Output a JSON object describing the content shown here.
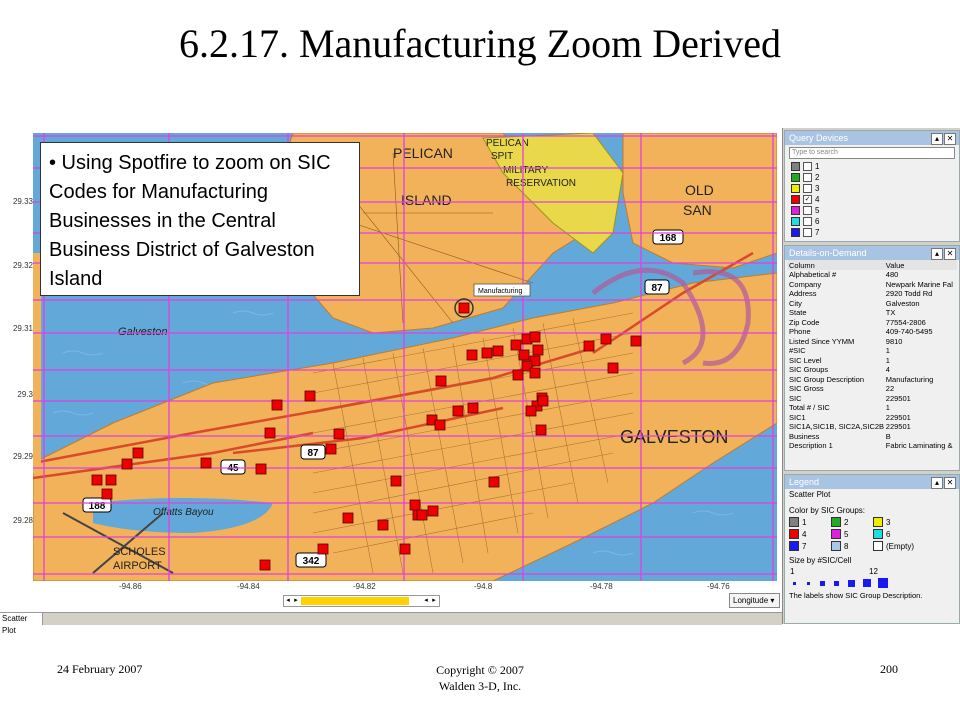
{
  "slide": {
    "title": "6.2.17. Manufacturing Zoom Derived",
    "footer_date": "24 February 2007",
    "footer_copyright_line1": "Copyright © 2007",
    "footer_copyright_line2": "Walden 3-D, Inc.",
    "page_number": "200"
  },
  "callout": {
    "text": "• Using Spotfire to zoom on SIC Codes for Manufacturing Businesses in the Central Business District of Galveston Island"
  },
  "plot": {
    "y_ticks": [
      "29.33",
      "29.32",
      "29.31",
      "29.3",
      "29.29",
      "29.28"
    ],
    "x_ticks": [
      "-94.86",
      "-94.84",
      "-94.82",
      "-94.8",
      "-94.78",
      "-94.76"
    ],
    "x_axis_column": "Longitude",
    "tab_label": "Scatter Plot",
    "marker_label": "Manufacturing",
    "marker_color": "#ee0000",
    "grid_color": "#e040e0"
  },
  "map_labels": {
    "pelican_island": "PELICAN",
    "island": "ISLAND",
    "pelican_spit": "PELICAN",
    "spit": "SPIT",
    "military": "MILITARY",
    "reservation": "RESERVATION",
    "old": "OLD",
    "san": "SAN",
    "galveston": "GALVESTON",
    "galveston_channel": "Galveston",
    "offatts_bayou": "Offatts Bayou",
    "scholes": "SCHOLES",
    "airport": "AIRPORT",
    "hwy_45": "45",
    "hwy_87": "87",
    "hwy_168": "168",
    "hwy_188": "188",
    "hwy_342": "342",
    "hwy_87b": "87"
  },
  "query_devices": {
    "title": "Query Devices",
    "search_placeholder": "Type to search",
    "items": [
      {
        "label": "1",
        "color": "#808080",
        "checked": false
      },
      {
        "label": "2",
        "color": "#22aa22",
        "checked": false
      },
      {
        "label": "3",
        "color": "#eeee00",
        "checked": false
      },
      {
        "label": "4",
        "color": "#ee0000",
        "checked": true
      },
      {
        "label": "5",
        "color": "#dd22dd",
        "checked": false
      },
      {
        "label": "6",
        "color": "#22dddd",
        "checked": false
      },
      {
        "label": "7",
        "color": "#1a1aee",
        "checked": false
      }
    ]
  },
  "details": {
    "title": "Details-on-Demand",
    "col_header": "Column",
    "val_header": "Value",
    "rows": [
      [
        "Alphabetical #",
        "480"
      ],
      [
        "Company",
        "Newpark Marine Fal"
      ],
      [
        "Address",
        "2920 Todd Rd"
      ],
      [
        "City",
        "Galveston"
      ],
      [
        "State",
        "TX"
      ],
      [
        "Zip Code",
        "77554-2806"
      ],
      [
        "Phone",
        "409-740-5495"
      ],
      [
        "Listed Since YYMM",
        "9810"
      ],
      [
        "#SIC",
        "1"
      ],
      [
        "SIC Level",
        "1"
      ],
      [
        "SIC Groups",
        "4"
      ],
      [
        "SIC Group Description",
        "Manufacturing"
      ],
      [
        "SIC Gross",
        "22"
      ],
      [
        "SIC",
        "229501"
      ],
      [
        "Total # / SIC",
        "1"
      ],
      [
        "SIC1",
        "229501"
      ],
      [
        "SIC1A,SIC1B, SIC2A,SIC2B",
        "229501"
      ],
      [
        "Business",
        "B"
      ],
      [
        "Description 1",
        "Fabric Laminating &"
      ]
    ]
  },
  "legend": {
    "title": "Legend",
    "plot_type": "Scatter Plot",
    "color_by": "Color by SIC Groups:",
    "items": [
      {
        "label": "1",
        "color": "#808080"
      },
      {
        "label": "2",
        "color": "#22aa22"
      },
      {
        "label": "3",
        "color": "#eeee00"
      },
      {
        "label": "4",
        "color": "#ee0000"
      },
      {
        "label": "5",
        "color": "#dd22dd"
      },
      {
        "label": "6",
        "color": "#22dddd"
      },
      {
        "label": "7",
        "color": "#1a1aee"
      },
      {
        "label": "8",
        "color": "#a8c8e8"
      },
      {
        "label": "(Empty)",
        "color": "#ffffff"
      }
    ],
    "size_by": "Size by #SIC/Cell",
    "size_min": "1",
    "size_max": "12",
    "note": "The labels show SIC Group Description."
  }
}
